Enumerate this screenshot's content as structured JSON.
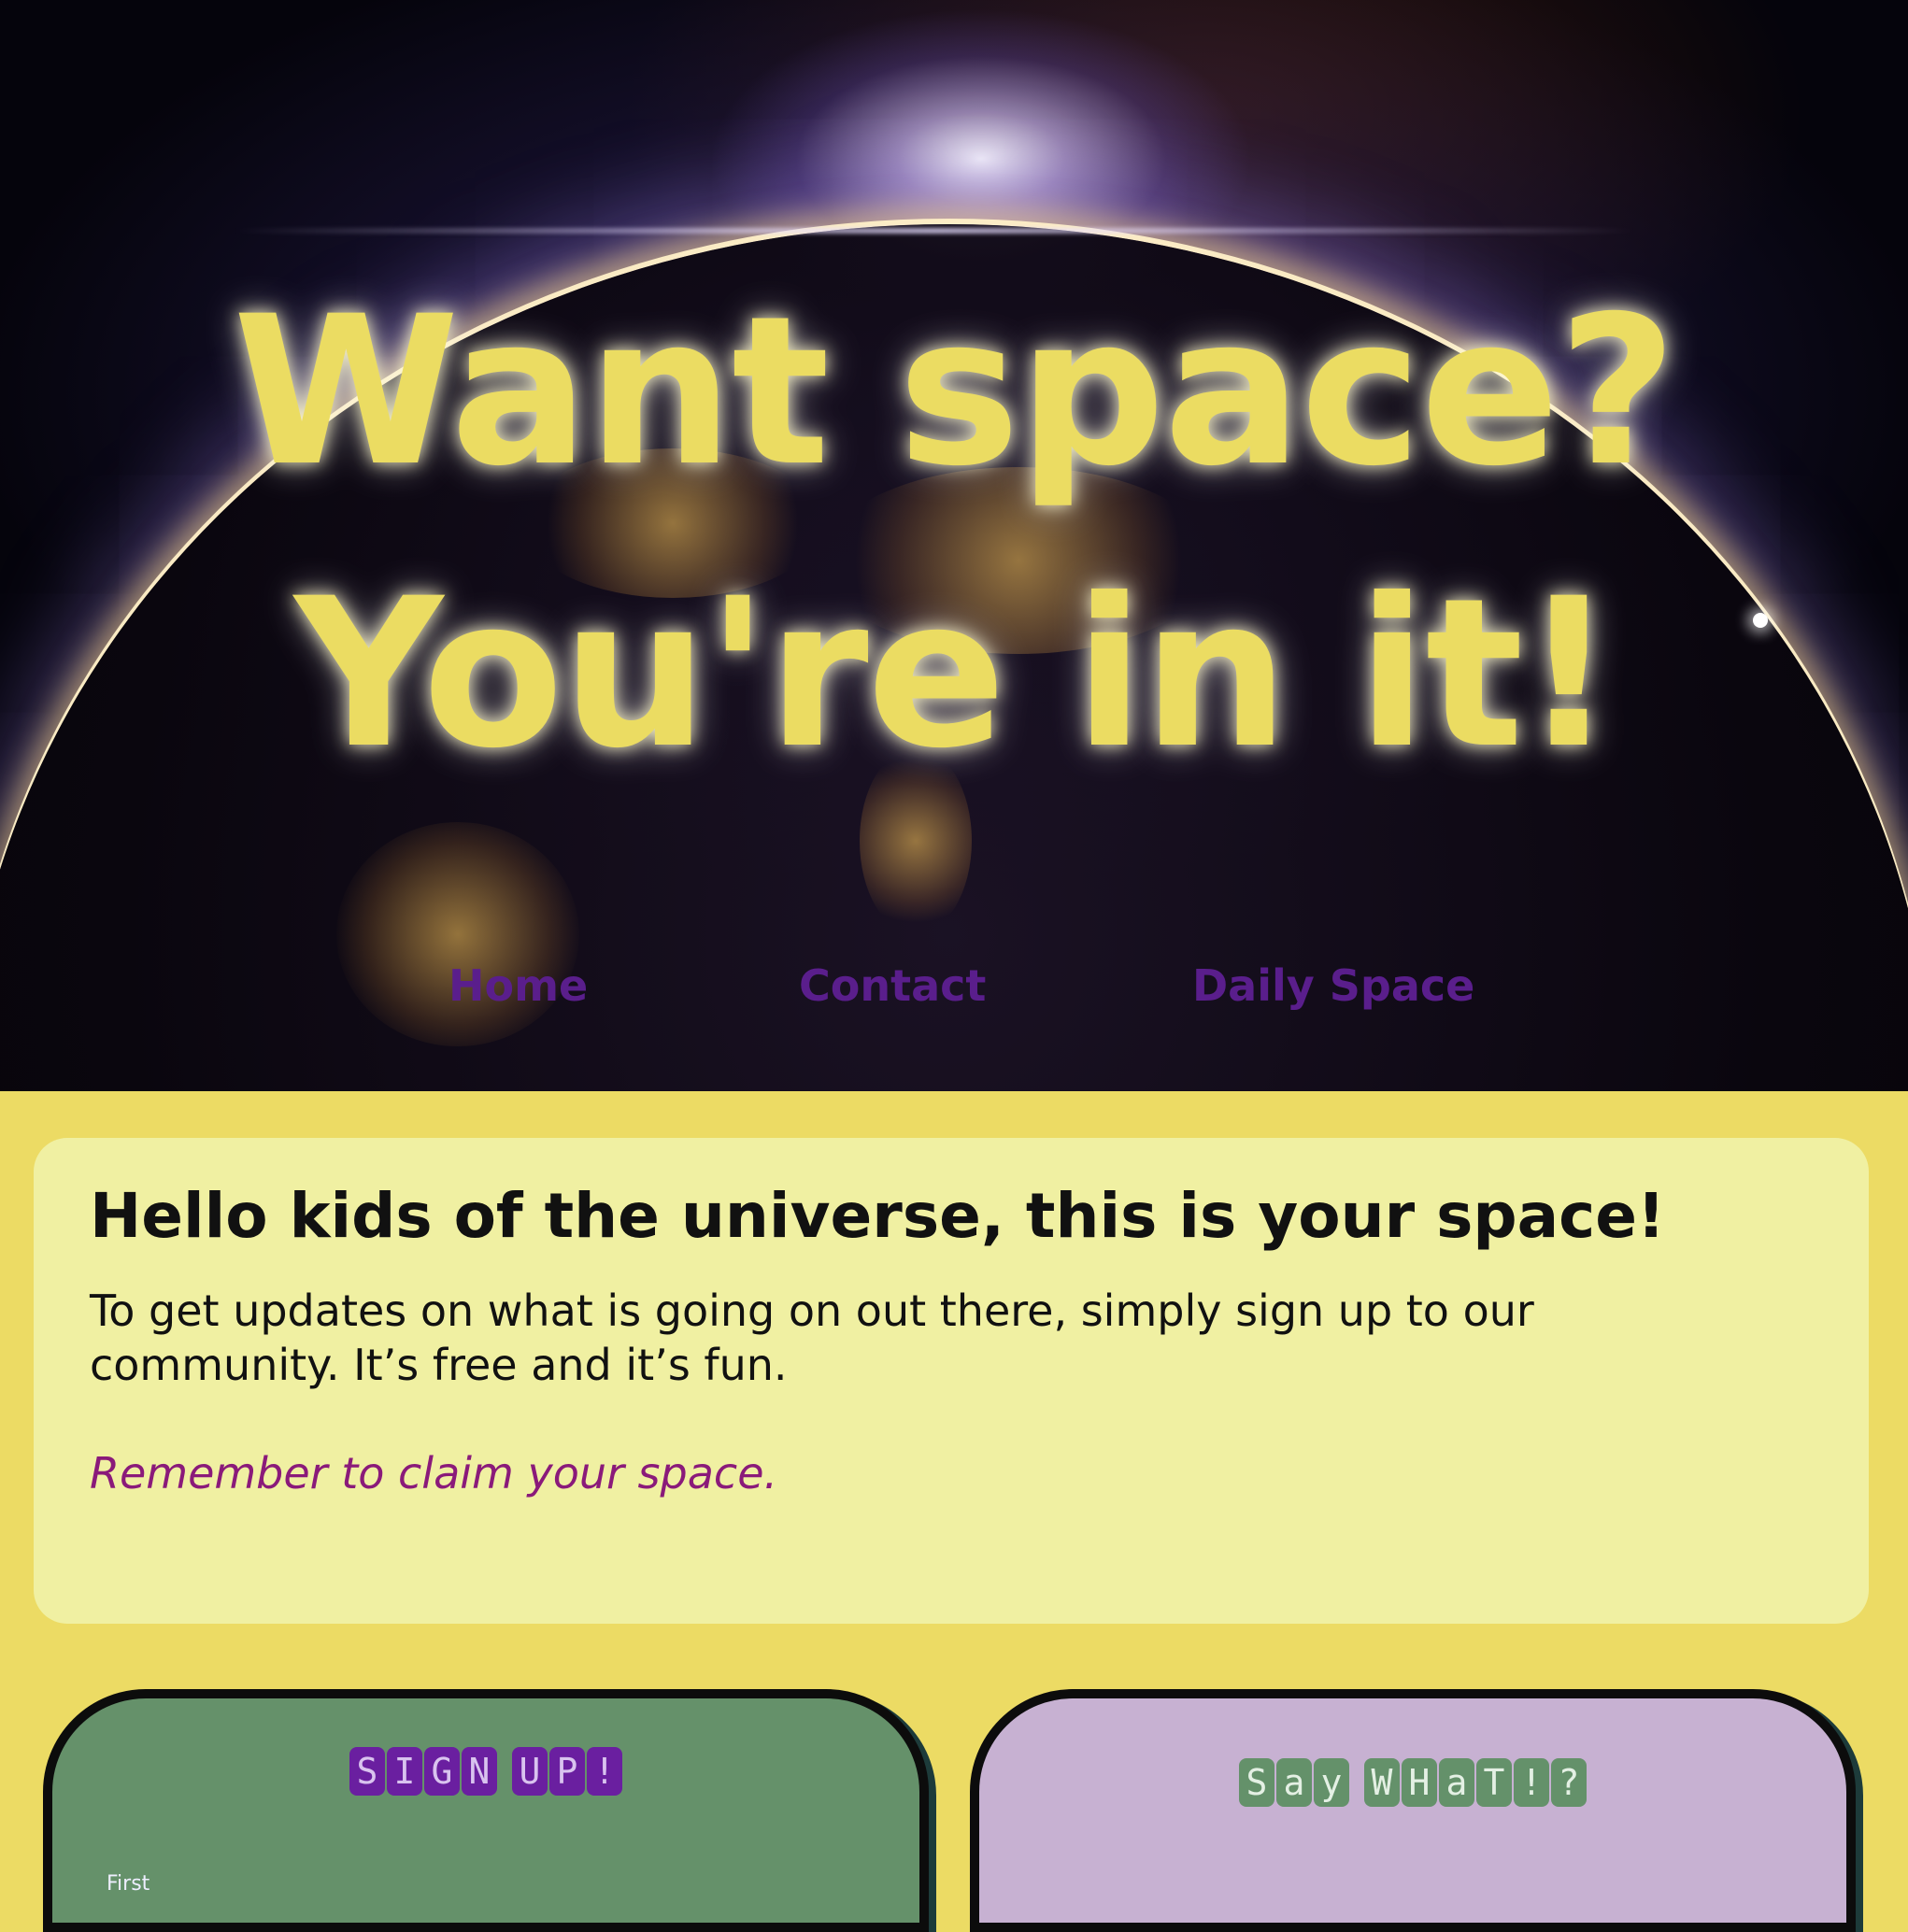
{
  "hero": {
    "headline_line1": "Want space?",
    "headline_line2": "You're in it!",
    "nav": [
      "Home",
      "Contact",
      "Daily Space"
    ]
  },
  "intro": {
    "heading": "Hello kids of the universe, this is your space!",
    "body": "To get updates on what is going on out there, simply sign up to our community. It’s free and it’s fun.",
    "reminder": "Remember to claim your space."
  },
  "panels": {
    "signup_title": "SIGN UP!",
    "say_what_title": "Say WHaT!?",
    "signup_first_field_label": "First"
  },
  "colors": {
    "page_background": "#ecdb64",
    "headline": "#ebdc62",
    "nav_link": "#5a1e8c",
    "intro_card": "#f0f0a2",
    "reminder_text": "#8a1a7a",
    "signup_panel": "#65916a",
    "say_what_panel": "#c7b1d2"
  }
}
